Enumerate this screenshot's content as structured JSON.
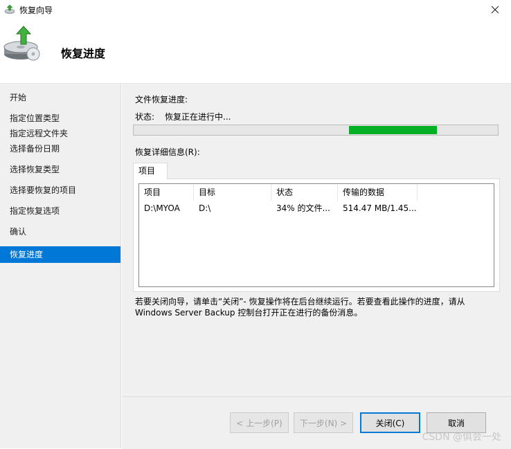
{
  "window": {
    "title": "恢复向导",
    "icon": "restore-wizard-icon"
  },
  "header": {
    "heading": "恢复进度",
    "icon": "backup-restore-disk-icon"
  },
  "sidebar": {
    "items": [
      {
        "label": "开始",
        "active": false
      },
      {
        "label": "指定位置类型",
        "active": false
      },
      {
        "label": "指定远程文件夹",
        "active": false
      },
      {
        "label": "选择备份日期",
        "active": false
      },
      {
        "label": "选择恢复类型",
        "active": false
      },
      {
        "label": "选择要恢复的项目",
        "active": false
      },
      {
        "label": "指定恢复选项",
        "active": false
      },
      {
        "label": "确认",
        "active": false
      },
      {
        "label": "恢复进度",
        "active": true
      }
    ]
  },
  "main": {
    "file_progress_label": "文件恢复进度:",
    "status_label": "状态:",
    "status_value": "恢复正在进行中...",
    "progress": {
      "segment_start": 0.59,
      "segment_end": 0.83,
      "color": "#06b025",
      "indeterminate": true
    },
    "details_label": "恢复详细信息(R):",
    "tab_label": "项目",
    "table": {
      "headers": [
        "项目",
        "目标",
        "状态",
        "传输的数据"
      ],
      "rows": [
        [
          "D:\\MYOA",
          "D:\\",
          "34% 的文件...",
          "514.47 MB/1.45..."
        ]
      ]
    },
    "notice_line1": "若要关闭向导，请单击“关闭”- 恢复操作将在后台继续运行。若要查看此操作的进度，请从",
    "notice_line2": "Windows Server Backup 控制台打开正在进行的备份消息。"
  },
  "footer": {
    "prev_label": "< 上一步(P)",
    "next_label": "下一步(N) >",
    "close_label": "关闭(C)",
    "cancel_label": "取消"
  },
  "watermark": "CSDN @俱会一处",
  "colors": {
    "accent": "#0078d7",
    "progress": "#06b025"
  }
}
